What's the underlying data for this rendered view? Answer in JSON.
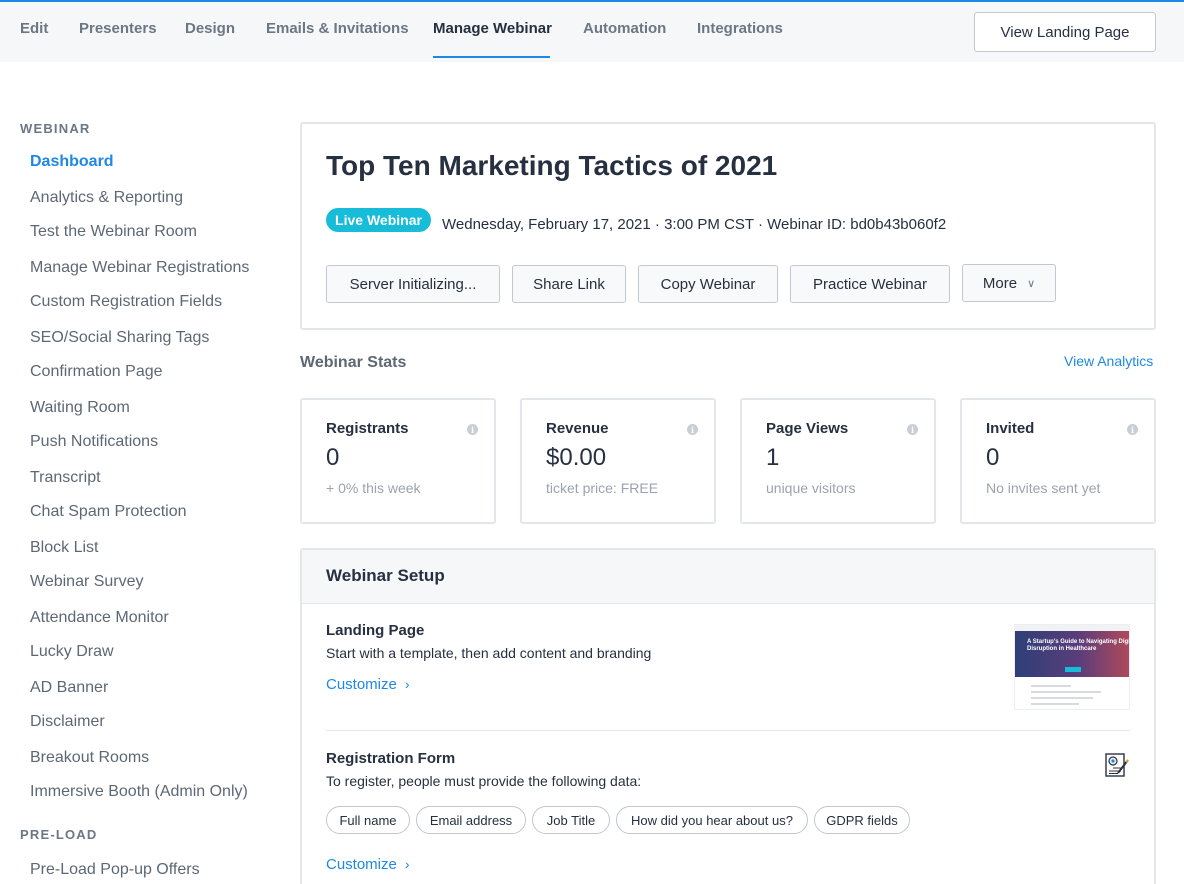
{
  "topnav": {
    "tabs": [
      {
        "label": "Edit"
      },
      {
        "label": "Presenters"
      },
      {
        "label": "Design"
      },
      {
        "label": "Emails & Invitations"
      },
      {
        "label": "Manage Webinar",
        "active": true
      },
      {
        "label": "Automation"
      },
      {
        "label": "Integrations"
      }
    ],
    "view_landing_label": "View Landing Page"
  },
  "sidebar": {
    "webinar_heading": "WEBINAR",
    "items": [
      {
        "label": "Dashboard",
        "active": true
      },
      {
        "label": "Analytics & Reporting"
      },
      {
        "label": "Test the Webinar Room"
      },
      {
        "label": "Manage Webinar Registrations"
      },
      {
        "label": "Custom Registration Fields"
      },
      {
        "label": "SEO/Social Sharing Tags"
      },
      {
        "label": "Confirmation Page"
      },
      {
        "label": "Waiting Room"
      },
      {
        "label": "Push Notifications"
      },
      {
        "label": "Transcript"
      },
      {
        "label": "Chat Spam Protection"
      },
      {
        "label": "Block List"
      },
      {
        "label": "Webinar Survey"
      },
      {
        "label": "Attendance Monitor"
      },
      {
        "label": "Lucky Draw"
      },
      {
        "label": "AD Banner"
      },
      {
        "label": "Disclaimer"
      },
      {
        "label": "Breakout Rooms"
      },
      {
        "label": "Immersive Booth (Admin Only)"
      }
    ],
    "preload_heading": "PRE-LOAD",
    "preload_items": [
      {
        "label": "Pre-Load Pop-up Offers"
      }
    ]
  },
  "webinar": {
    "title": "Top Ten Marketing Tactics of 2021",
    "badge": "Live Webinar",
    "meta": "Wednesday, February 17, 2021 · 3:00 PM CST · Webinar ID: bd0b43b060f2",
    "actions": {
      "server": "Server Initializing...",
      "share": "Share Link",
      "copy": "Copy Webinar",
      "practice": "Practice Webinar",
      "more": "More"
    }
  },
  "stats": {
    "title": "Webinar Stats",
    "view_analytics": "View Analytics",
    "cards": [
      {
        "label": "Registrants",
        "value": "0",
        "sub": "+ 0% this week"
      },
      {
        "label": "Revenue",
        "value": "$0.00",
        "sub": "ticket price: FREE"
      },
      {
        "label": "Page Views",
        "value": "1",
        "sub": "unique visitors"
      },
      {
        "label": "Invited",
        "value": "0",
        "sub": "No invites sent yet"
      }
    ]
  },
  "setup": {
    "title": "Webinar Setup",
    "landing": {
      "title": "Landing Page",
      "desc": "Start with a template, then add content and branding",
      "customize": "Customize",
      "thumb_heading": "A Startup's Guide to Navigating Digital Disruption in Healthcare"
    },
    "registration": {
      "title": "Registration Form",
      "desc": "To register, people must provide the following data:",
      "fields": [
        "Full name",
        "Email address",
        "Job Title",
        "How did you hear about us?",
        "GDPR fields"
      ],
      "customize": "Customize"
    }
  },
  "colors": {
    "accent": "#1e88e5",
    "badge": "#16bcd8",
    "text": "#263040",
    "muted": "#6b7785"
  },
  "icons": {
    "more_chevron": "chevron-down-icon",
    "customize_chevron": "chevron-right-icon",
    "stat_info": "info-icon",
    "form": "certificate-form-icon"
  }
}
